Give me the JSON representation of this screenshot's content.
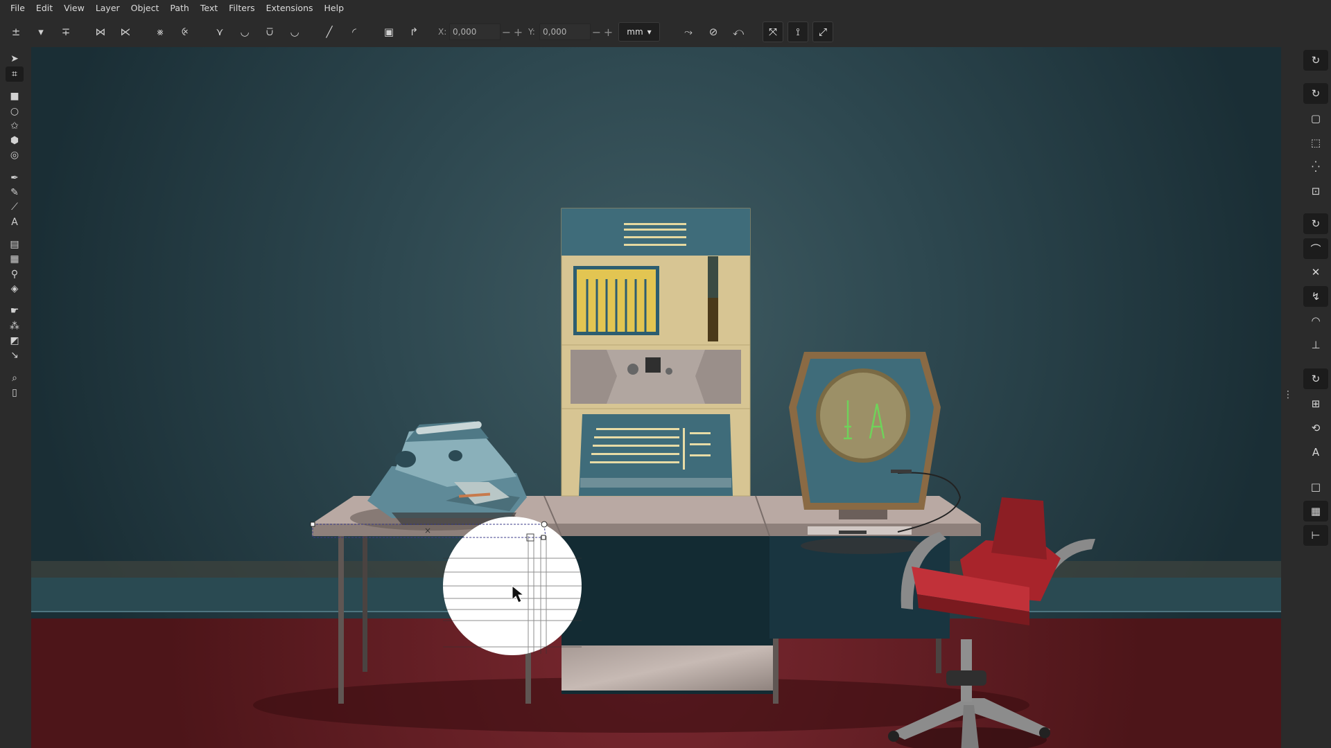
{
  "menu": [
    "File",
    "Edit",
    "View",
    "Layer",
    "Object",
    "Path",
    "Text",
    "Filters",
    "Extensions",
    "Help"
  ],
  "toolbar": {
    "x_label": "X:",
    "x_value": "0,000",
    "y_label": "Y:",
    "y_value": "0,000",
    "unit": "mm"
  },
  "icons": {
    "left_tools": [
      "selector-icon",
      "node-tool-icon",
      "rectangle-icon",
      "ellipse-icon",
      "star-icon",
      "box3d-icon",
      "spiral-icon",
      "pen-icon",
      "pencil-icon",
      "calligraphy-icon",
      "text-tool-icon",
      "gradient-icon",
      "mesh-icon",
      "dropper-icon",
      "paint-bucket-icon",
      "tweak-icon",
      "spray-icon",
      "eraser-icon",
      "connector-icon",
      "zoom-icon",
      "pages-icon"
    ],
    "right_snap": [
      "snap-toggle-icon",
      "snap-bbox-icon",
      "snap-bbox-edge-icon",
      "snap-bbox-corner-icon",
      "snap-bbox-midpoint-icon",
      "snap-bbox-center-icon",
      "snap-nodes-icon",
      "snap-path-icon",
      "snap-intersection-icon",
      "snap-cusp-icon",
      "snap-smooth-icon",
      "snap-line-midpoint-icon",
      "snap-others-icon",
      "snap-object-center-icon",
      "snap-rotation-icon",
      "snap-text-baseline-icon",
      "snap-page-border-icon",
      "snap-grid-icon",
      "snap-guide-icon"
    ]
  },
  "colors": {
    "ui_bg": "#2b2b2b",
    "wall": "#203a43",
    "floor": "#6b1f26",
    "desk": "#b9a9a3",
    "computer_panel": "#d7c593",
    "chair": "#8c1e24"
  }
}
